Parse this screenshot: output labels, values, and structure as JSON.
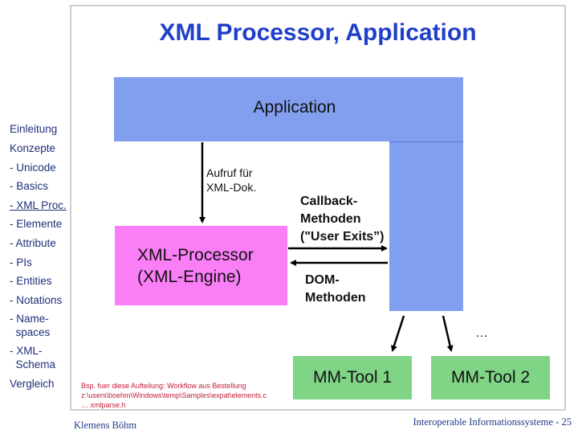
{
  "slide": {
    "title": "XML Processor, Application"
  },
  "nav": {
    "items": [
      {
        "label": "Einleitung",
        "current": false
      },
      {
        "label": "Konzepte",
        "current": false
      },
      {
        "label": "- Unicode",
        "current": false
      },
      {
        "label": "- Basics",
        "current": false
      },
      {
        "label": "- XML Proc.",
        "current": true
      },
      {
        "label": "- Elemente",
        "current": false
      },
      {
        "label": "- Attribute",
        "current": false
      },
      {
        "label": "- PIs",
        "current": false
      },
      {
        "label": "- Entities",
        "current": false
      },
      {
        "label": "- Notations",
        "current": false
      },
      {
        "label": "- Name-\n  spaces",
        "current": false
      },
      {
        "label": "- XML-\n  Schema",
        "current": false
      },
      {
        "label": "Vergleich",
        "current": false
      }
    ]
  },
  "diagram": {
    "application_label": "Application",
    "processor_label": "XML-Processor\n(XML-Engine)",
    "aufruf_label": "Aufruf für\nXML-Dok.",
    "callback_label": "Callback-\nMethoden\n(\"User Exits”)",
    "dom_label": "DOM-\nMethoden",
    "ellipsis": "…",
    "tools": [
      "MM-Tool 1",
      "MM-Tool 2"
    ],
    "colors": {
      "application": "#829fef",
      "processor": "#fa7ef6",
      "tool": "#7fd486",
      "title": "#1f3fc8",
      "note": "#c0203a"
    }
  },
  "note": {
    "text": "Bsp. fuer diese Aufteilung: Workflow aus Bestellung\nz:\\users\\boehm\\Windows\\temp\\Samples\\expat\\elements.c\n… xmlparse.h"
  },
  "footer": {
    "author": "Klemens Böhm",
    "course_page": "Interoperable Informationssysteme - 25"
  }
}
